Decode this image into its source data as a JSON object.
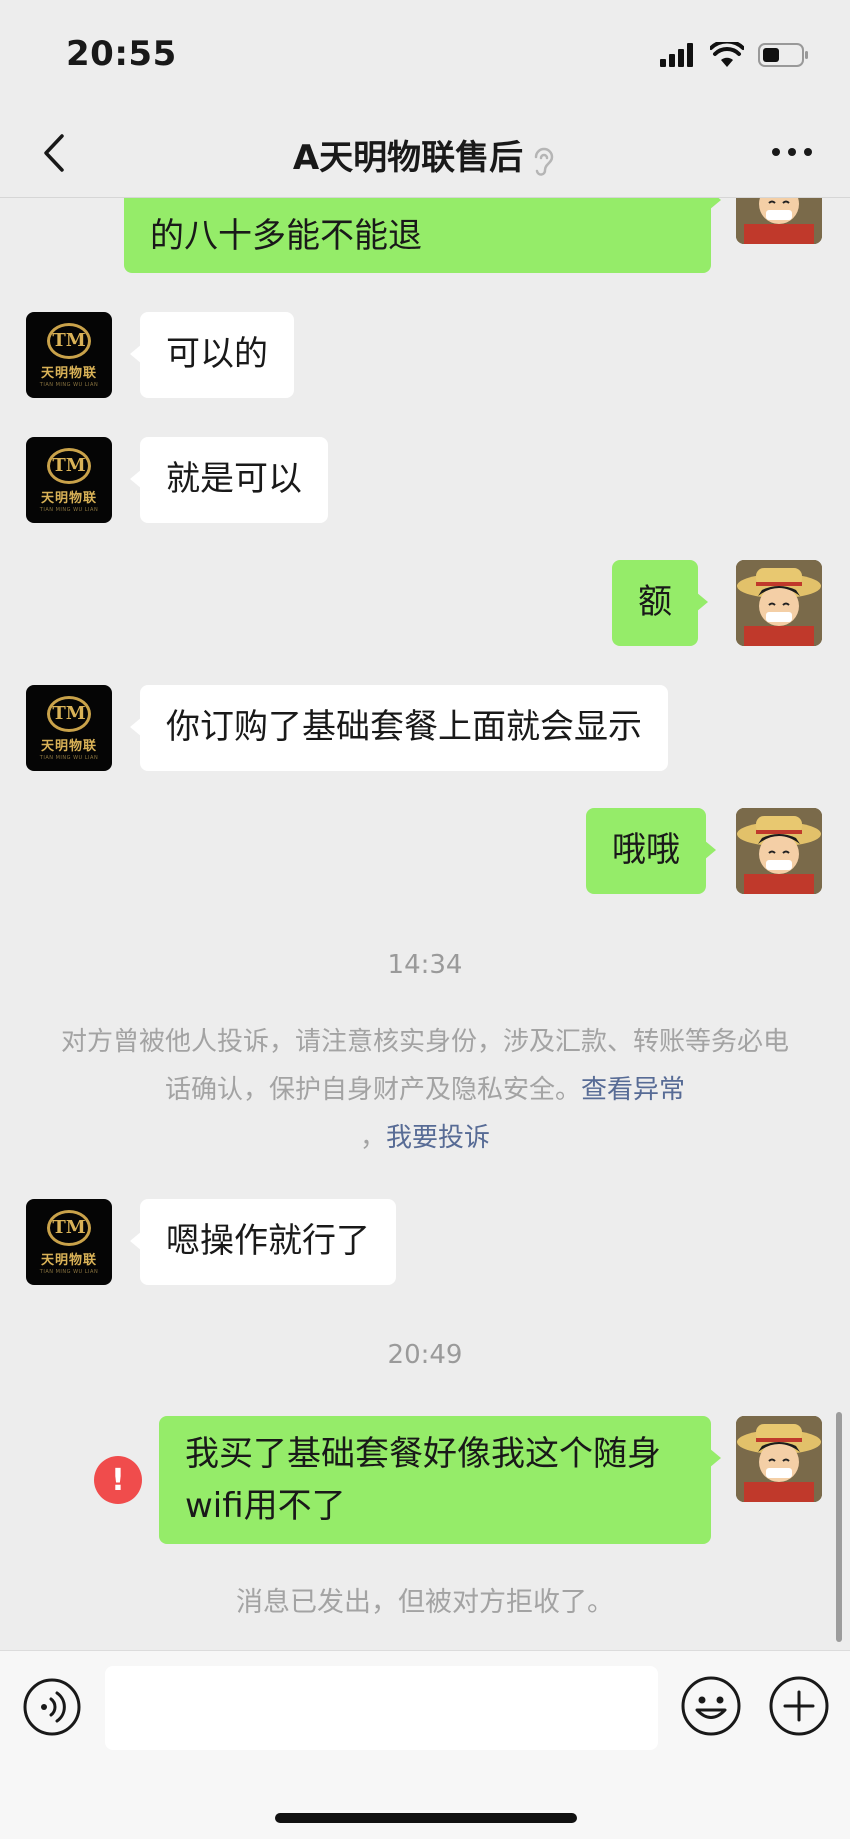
{
  "status_bar": {
    "time": "20:55"
  },
  "header": {
    "title": "A天明物联售后"
  },
  "logo": {
    "mark": "TM",
    "name": "天明物联",
    "sub": "TIAN MING WU LIAN"
  },
  "messages": [
    {
      "from": "me",
      "text": "的八十多能不能退"
    },
    {
      "from": "them",
      "text": "可以的"
    },
    {
      "from": "them",
      "text": "就是可以"
    },
    {
      "from": "me",
      "text": "额"
    },
    {
      "from": "them",
      "text": "你订购了基础套餐上面就会显示"
    },
    {
      "from": "me",
      "text": "哦哦"
    },
    {
      "from": "them",
      "text": "嗯操作就行了"
    },
    {
      "from": "me",
      "text": "我买了基础套餐好像我这个随身wifi用不了"
    }
  ],
  "timestamps": [
    "14:34",
    "20:49"
  ],
  "notice": {
    "text": "对方曾被他人投诉，请注意核实身份，涉及汇款、转账等务必电话确认，保护自身财产及隐私安全。",
    "link_view": "查看异常",
    "separator": "，",
    "link_report": "我要投诉"
  },
  "failed_mark": "!",
  "rejected_text": "消息已发出，但被对方拒收了。",
  "colors": {
    "outgoing_bubble": "#95ec69",
    "incoming_bubble": "#ffffff",
    "link": "#576b95",
    "error": "#f04c4c"
  },
  "icons": [
    "back-icon",
    "ear-icon",
    "more-icon",
    "voice-icon",
    "emoji-icon",
    "plus-icon"
  ]
}
